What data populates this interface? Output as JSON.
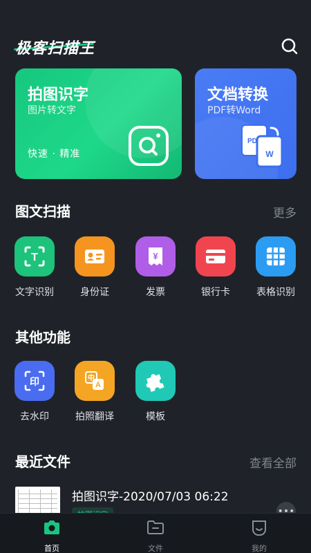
{
  "app": {
    "title": "极客扫描王"
  },
  "header": {
    "search_icon": "search-icon"
  },
  "cards": {
    "ocr": {
      "title": "拍图识字",
      "subtitle": "图片转文字",
      "tagline": "快速 · 精准",
      "color": "#1ccd82"
    },
    "convert": {
      "title": "文档转换",
      "subtitle": "PDF转Word",
      "color": "#4476f2",
      "pdf_text": "PDF",
      "word_text": "W"
    }
  },
  "scan_section": {
    "title": "图文扫描",
    "more_label": "更多",
    "items": [
      {
        "label": "文字识别",
        "icon": "text-recognition-icon",
        "glyph": "T",
        "color": "#1dc27b"
      },
      {
        "label": "身份证",
        "icon": "id-card-icon",
        "glyph": "",
        "color": "#f5941f"
      },
      {
        "label": "发票",
        "icon": "invoice-icon",
        "glyph": "¥",
        "color": "#b05de8"
      },
      {
        "label": "银行卡",
        "icon": "bank-card-icon",
        "glyph": "",
        "color": "#f0454f"
      },
      {
        "label": "表格识别",
        "icon": "table-icon",
        "glyph": "",
        "color": "#2c9cf2"
      }
    ]
  },
  "other_section": {
    "title": "其他功能",
    "items": [
      {
        "label": "去水印",
        "icon": "watermark-icon",
        "glyph": "印",
        "color": "#4a6cf0"
      },
      {
        "label": "拍照翻译",
        "icon": "translate-icon",
        "glyph": "中",
        "glyph2": "A",
        "color": "#f5a524"
      },
      {
        "label": "模板",
        "icon": "puzzle-icon",
        "glyph": "",
        "color": "#1fc9b5"
      }
    ]
  },
  "recent_section": {
    "title": "最近文件",
    "more_label": "查看全部",
    "files": [
      {
        "name": "拍图识字-2020/07/03 06:22",
        "tag": "拍图识字"
      }
    ]
  },
  "tabbar": {
    "items": [
      {
        "label": "首页",
        "icon": "home-icon",
        "active": true
      },
      {
        "label": "文件",
        "icon": "folder-icon",
        "active": false
      },
      {
        "label": "我的",
        "icon": "profile-icon",
        "active": false
      }
    ]
  },
  "colors": {
    "background": "#1f2329",
    "accent": "#19c482",
    "muted_text": "#7f8590"
  }
}
